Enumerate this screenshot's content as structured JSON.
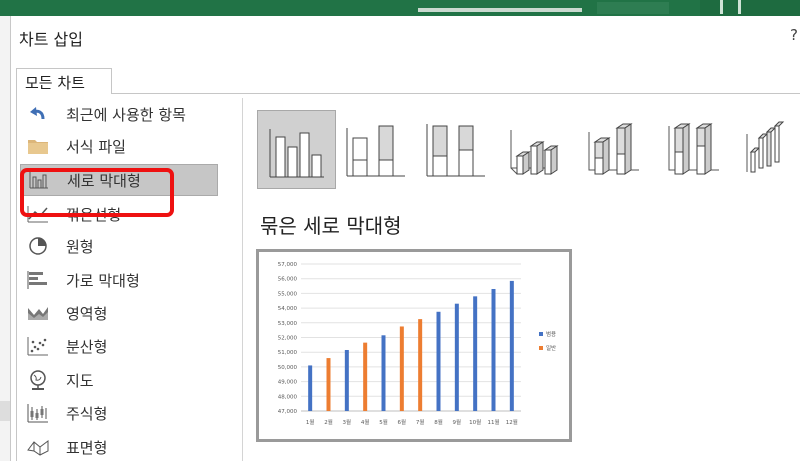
{
  "dialog": {
    "title": "차트 삽입",
    "help_icon": "?",
    "tab_label": "모든 차트"
  },
  "categories": [
    {
      "label": "최근에 사용한 항목",
      "icon": "recent-icon"
    },
    {
      "label": "서식 파일",
      "icon": "folder-icon"
    },
    {
      "label": "세로 막대형",
      "icon": "column-chart-icon",
      "selected": true
    },
    {
      "label": "꺾은선형",
      "icon": "line-chart-icon"
    },
    {
      "label": "원형",
      "icon": "pie-chart-icon"
    },
    {
      "label": "가로 막대형",
      "icon": "bar-chart-icon"
    },
    {
      "label": "영역형",
      "icon": "area-chart-icon"
    },
    {
      "label": "분산형",
      "icon": "scatter-chart-icon"
    },
    {
      "label": "지도",
      "icon": "map-icon"
    },
    {
      "label": "주식형",
      "icon": "stock-chart-icon"
    },
    {
      "label": "표면형",
      "icon": "surface-chart-icon"
    }
  ],
  "subtypes": [
    {
      "name": "clustered-column",
      "selected": true
    },
    {
      "name": "stacked-column"
    },
    {
      "name": "100-stacked-column"
    },
    {
      "name": "3d-clustered-column"
    },
    {
      "name": "3d-stacked-column"
    },
    {
      "name": "3d-100-stacked-column"
    },
    {
      "name": "3d-column"
    }
  ],
  "selected_subtype_title": "묶은 세로 막대형",
  "colors": {
    "accent_red": "#ee1111",
    "excel_green": "#217346",
    "series_blue": "#4472c4",
    "series_orange": "#ed7d31"
  },
  "chart_data": {
    "type": "bar",
    "categories": [
      "1월",
      "2월",
      "3월",
      "4월",
      "5월",
      "6월",
      "7월",
      "8월",
      "9월",
      "10월",
      "11월",
      "12월"
    ],
    "values": [
      50100,
      50600,
      51150,
      51650,
      52150,
      52750,
      53250,
      53750,
      54300,
      54800,
      55300,
      55850
    ],
    "bar_series": [
      "범용",
      "일반",
      "범용",
      "일반",
      "범용",
      "일반",
      "일반",
      "범용",
      "범용",
      "범용",
      "범용",
      "범용"
    ],
    "legend": [
      {
        "name": "범용",
        "color": "#4472c4"
      },
      {
        "name": "일반",
        "color": "#ed7d31"
      }
    ],
    "ylim": [
      47000,
      57000
    ],
    "yticks": [
      "47,000",
      "48,000",
      "49,000",
      "50,000",
      "51,000",
      "52,000",
      "53,000",
      "54,000",
      "55,000",
      "56,000",
      "57,000"
    ],
    "grid": true,
    "legend_position": "right"
  }
}
